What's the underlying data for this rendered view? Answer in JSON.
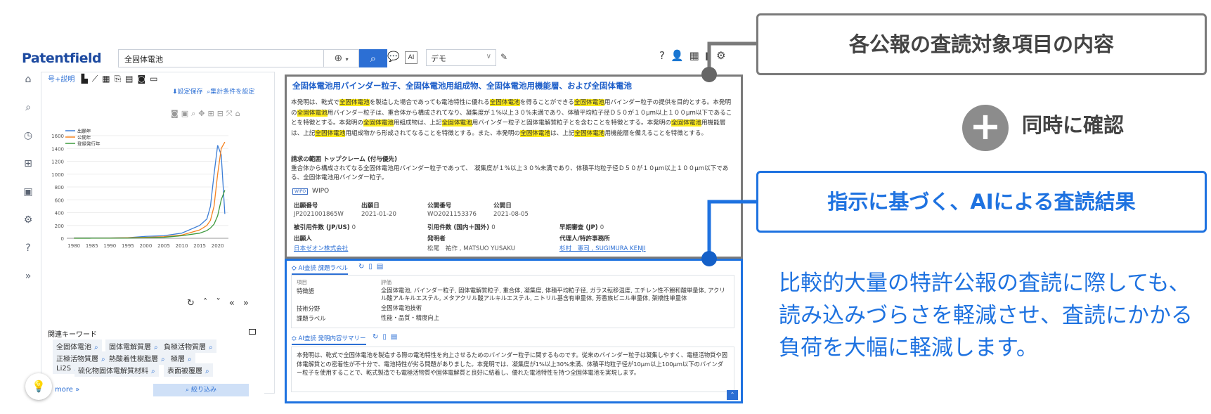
{
  "app": {
    "logo": "Patentfield"
  },
  "header": {
    "search_value": "全固体電池",
    "demo_select": "デモ",
    "icons": [
      "help-icon",
      "add-user-icon",
      "grid-icon",
      "notification-icon",
      "gear-icon"
    ]
  },
  "left_panel": {
    "tool_label": "号+説明",
    "save_setting": "設定保存",
    "aggregate_setting": "集計条件を設定",
    "chart_data": {
      "type": "line",
      "x": [
        1980,
        1985,
        1990,
        1995,
        2000,
        2005,
        2010,
        2015,
        2017,
        2018,
        2019,
        2020,
        2021,
        2022
      ],
      "xticks": [
        1980,
        1985,
        1990,
        1995,
        2000,
        2005,
        2010,
        2015,
        2020
      ],
      "ylim": [
        0,
        1600
      ],
      "yticks": [
        0,
        200,
        400,
        600,
        800,
        1000,
        1200,
        1400,
        1600
      ],
      "legend_position": "top-left",
      "series": [
        {
          "name": "出願年",
          "color": "#3d7ed6",
          "values": [
            5,
            5,
            5,
            10,
            30,
            40,
            80,
            200,
            300,
            500,
            1000,
            1450,
            1300,
            380
          ]
        },
        {
          "name": "公開年",
          "color": "#f58220",
          "values": [
            2,
            3,
            4,
            8,
            15,
            25,
            50,
            130,
            200,
            280,
            500,
            1000,
            1400,
            1500
          ]
        },
        {
          "name": "登録発行年",
          "color": "#3e9a3e",
          "values": [
            0,
            1,
            1,
            3,
            8,
            15,
            40,
            80,
            120,
            160,
            220,
            350,
            600,
            750
          ]
        }
      ]
    },
    "keywords_title": "関連キーワード",
    "keywords": [
      "全固体電池",
      "固体電解質層",
      "負極活物質層",
      "正極活物質層",
      "熱酸着性樹脂層",
      "極層",
      "Li2S",
      "硫化物固体電解質材料",
      "表面被覆層"
    ],
    "more_link": "more »",
    "narrow_button": "絞り込み"
  },
  "doc": {
    "title": "全固体電池用バインダー粒子、全固体電池用組成物、全固体電池用機能層、および全固体電池",
    "abstract_parts": [
      {
        "t": "本発明は、乾式で",
        "h": false
      },
      {
        "t": "全固体電池",
        "h": true
      },
      {
        "t": "を製造した場合であっても電池特性に優れる",
        "h": false
      },
      {
        "t": "全固体電池",
        "h": true
      },
      {
        "t": "を得ることができる",
        "h": false
      },
      {
        "t": "全固体電池",
        "h": true
      },
      {
        "t": "用バインダー粒子の提供を目的とする。本発明の",
        "h": false
      },
      {
        "t": "全固体電池",
        "h": true
      },
      {
        "t": "用バインダー粒子は、重合体から構成されてなり、凝集度が１%以上３０%未満であり、体積平均粒子径Ｄ５０が１０μm以上１００μm以下であることを特徴とする。本発明の",
        "h": false
      },
      {
        "t": "全固体電池",
        "h": true
      },
      {
        "t": "用組成物は、上記",
        "h": false
      },
      {
        "t": "全固体電池",
        "h": true
      },
      {
        "t": "用バインダー粒子と固体電解質粒子とを含むことを特徴とする。本発明の",
        "h": false
      },
      {
        "t": "全固体電池",
        "h": true
      },
      {
        "t": "用機能層は、上記",
        "h": false
      },
      {
        "t": "全固体電池",
        "h": true
      },
      {
        "t": "用組成物から形成されてなることを特徴とする。また、本発明の",
        "h": false
      },
      {
        "t": "全固体電池",
        "h": true
      },
      {
        "t": "は、上記",
        "h": false
      },
      {
        "t": "全固体電池",
        "h": true
      },
      {
        "t": "用機能層を備えることを特徴とする。",
        "h": false
      }
    ],
    "claim_title": "請求の範囲 トップクレーム (付与優先)",
    "claim_text": "重合体から構成されてなる全固体電池用バインダー粒子であって、　凝集度が１%以上３０%未満であり、体積平均粒子径Ｄ５０が１０μm以上１００μm以下である、全固体電池用バインダー粒子。",
    "office_badge": "WIPO",
    "office": "WIPO",
    "fields": {
      "app_no_label": "出願番号",
      "app_no": "JP2021001865W",
      "app_date_label": "出願日",
      "app_date": "2021-01-20",
      "pub_no_label": "公開番号",
      "pub_no": "WO2021153376",
      "pub_date_label": "公開日",
      "pub_date": "2021-08-05",
      "cited_label": "被引用件数 (JP/US)",
      "cited": "0",
      "citing_label": "引用件数 (国内＋国外)",
      "citing": "0",
      "exam_label": "早期審査 (JP)",
      "exam": "0",
      "applicant_label": "出願人",
      "applicant": "日本ゼオン株式会社",
      "inventor_label": "発明者",
      "inventor": "松尾　祐作 , MATSUO YUSAKU",
      "agent_label": "代理人/特許事務所",
      "agent": "杉村　憲司 , SUGIMURA KENJI"
    }
  },
  "ai": {
    "tab1": "AI査読 課題ラベル",
    "table_head_item": "項目",
    "table_head_eval": "評価",
    "rows": [
      {
        "k": "特徴語",
        "v": "全固体電池, バインダー粒子, 固体電解質粒子, 重合体, 凝集度, 体積平均粒子径, ガラス転移温度, エチレン性不飽和酸単量体, アクリル酸アルキルエステル, メタアクリル酸アルキルエステル, ニトリル基含有単量体, 芳香族ビニル単量体, 架橋性単量体"
      },
      {
        "k": "技術分野",
        "v": "全固体電池技術"
      },
      {
        "k": "課題ラベル",
        "v": "性能・品質・精度向上"
      }
    ],
    "tab2": "AI査読 発明内容サマリー",
    "summary": "本発明は、乾式で全固体電池を製造する際の電池特性を向上させるためのバインダー粒子に関するものです。従来のバインダー粒子は凝集しやすく、電極活物質や固体電解質との密着性が不十分で、電池特性が劣る問題がありました。本発明では、凝集度が1%以上30%未満、体積平均粒子径が10μm以上100μm以下のバインダー粒子を使用することで、乾式製造でも電極活物質や固体電解質と良好に結着し、優れた電池特性を持つ全固体電池を実現します。"
  },
  "callouts": {
    "box1": "各公報の査読対象項目の内容",
    "plus_text": "同時に確認",
    "box2": "指示に基づく、AIによる査読結果",
    "description": "比較的大量の特許公報の査読に際しても、読み込みづらさを軽減させ、査読にかかる負荷を大幅に軽減します。"
  },
  "colors": {
    "accent": "#1e72e0",
    "gray_frame": "#7a7a7a",
    "highlight": "#ffec1a"
  }
}
